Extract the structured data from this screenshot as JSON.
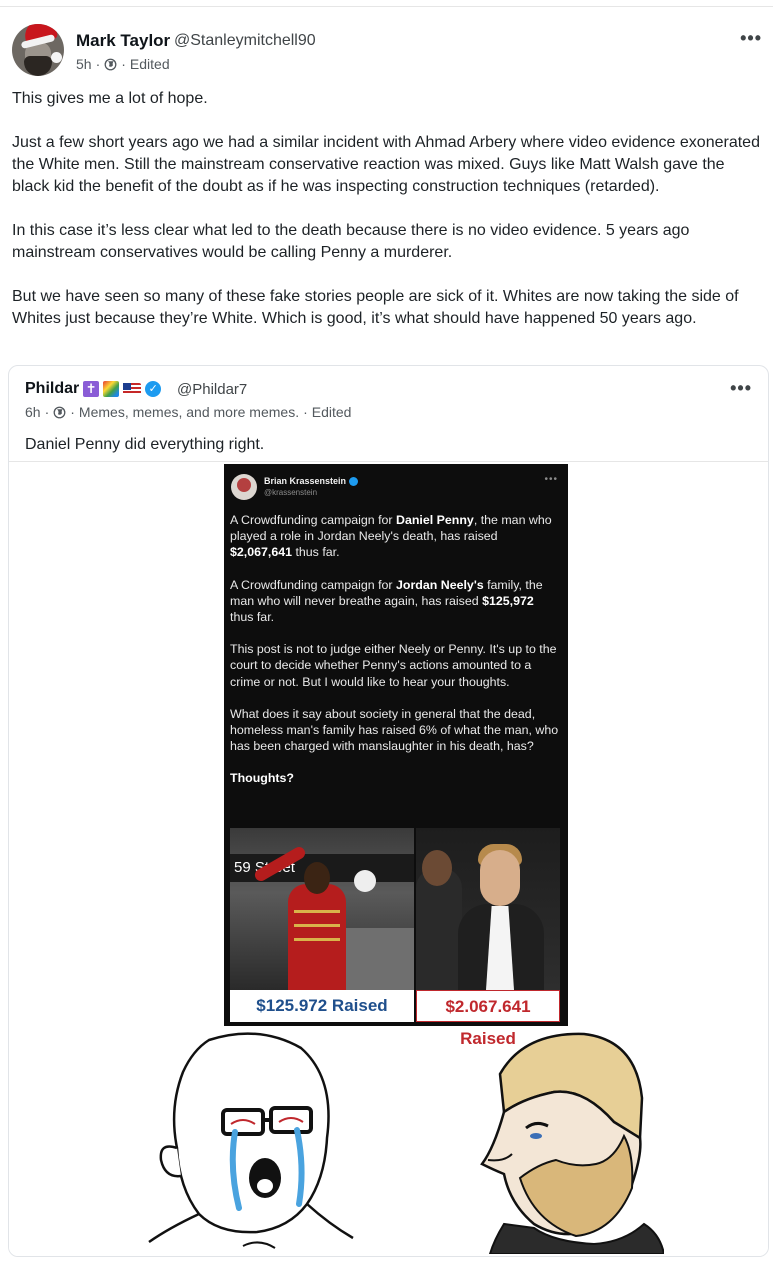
{
  "post": {
    "author_name": "Mark Taylor",
    "author_handle": "@Stanleymitchell90",
    "time": "5h",
    "visibility_icon": "globe-icon",
    "edited": "Edited",
    "more_icon": "more-horizontal-icon",
    "body": [
      "This gives me a lot of hope.",
      "Just a few short years ago we had a similar incident with Ahmad Arbery where video evidence exonerated the White men. Still the mainstream conservative reaction was mixed. Guys like Matt Walsh gave the black kid the benefit of the doubt as if he was inspecting construction techniques (retarded).",
      "In this case it’s less clear what led to the death because there is no video evidence. 5 years ago mainstream conservatives would be calling Penny a murderer.",
      "But we have seen so many of these fake stories people are sick of it. Whites are now taking the side of Whites just because they’re White. Which is good, it’s what should have happened 50 years ago."
    ]
  },
  "quote": {
    "author_name": "Phildar",
    "author_handle": "@Phildar7",
    "time": "6h",
    "group": "Memes, memes, and more memes.",
    "edited": "Edited",
    "text": "Daniel Penny did everything right.",
    "flag_cross_glyph": "✝",
    "verified_glyph": "✓",
    "image": {
      "tweet_author": "Brian Krassenstein",
      "tweet_handle": "@krassenstein",
      "tweet_p1_a": "A Crowdfunding campaign for ",
      "tweet_p1_name": "Daniel Penny",
      "tweet_p1_b": ", the man who played a role in Jordan Neely's death, has raised ",
      "tweet_p1_amount": "$2,067,641",
      "tweet_p1_c": " thus far.",
      "tweet_p2_a": "A Crowdfunding campaign for ",
      "tweet_p2_name": "Jordan Neely's",
      "tweet_p2_b": " family, the man who will never breathe again, has raised ",
      "tweet_p2_amount": "$125,972",
      "tweet_p2_c": " thus far.",
      "tweet_p3": "This post is not to judge either Neely or Penny.  It's up to the court to decide whether Penny's actions amounted to a crime or not. But I would like to hear your thoughts.",
      "tweet_p4": "What does it say about society in general that the dead, homeless man's family has raised 6% of what the man, who has been charged with manslaughter in his death, has?",
      "tweet_p5": "Thoughts?",
      "sign_text": "59 Street",
      "raised_left": "$125.972 Raised",
      "raised_right": "$2.067.641 Raised"
    }
  },
  "colors": {
    "text_primary": "#0f1419",
    "text_secondary": "#53595e",
    "verified_blue": "#1d9bf0",
    "raised_blue": "#1f4f8c",
    "raised_red": "#c0282d"
  }
}
